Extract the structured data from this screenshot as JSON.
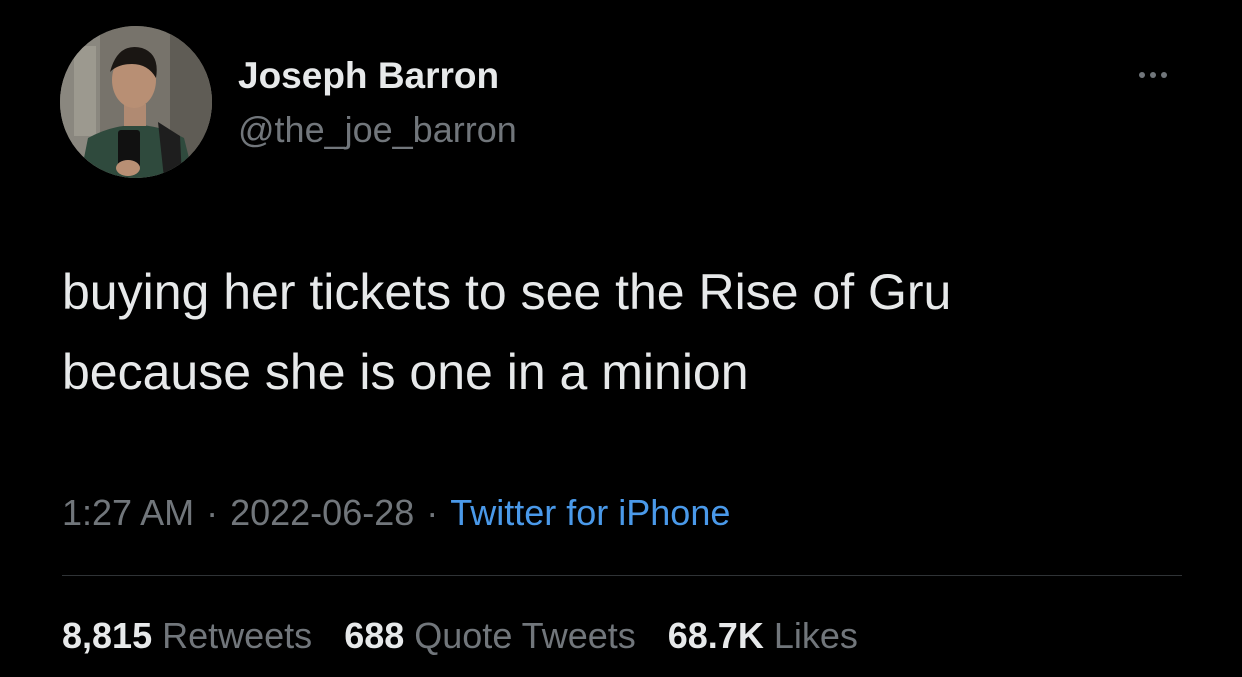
{
  "tweet": {
    "author": {
      "name": "Joseph Barron",
      "handle": "@the_joe_barron"
    },
    "text_lines": [
      "buying her tickets to see the Rise of Gru",
      "because she is one in a minion"
    ],
    "time": "1:27 AM",
    "separator": "·",
    "date": "2022-06-28",
    "source": "Twitter for iPhone",
    "stats": {
      "retweets_count": "8,815",
      "retweets_label": "Retweets",
      "quotes_count": "688",
      "quotes_label": "Quote Tweets",
      "likes_count": "68.7K",
      "likes_label": "Likes"
    }
  },
  "icons": {
    "more": "more-horizontal-icon",
    "avatar": "profile-photo"
  },
  "colors": {
    "background": "#000000",
    "primary_text": "#e7e9ea",
    "secondary_text": "#71767b",
    "link": "#4a99e9",
    "divider": "#2f3336"
  }
}
